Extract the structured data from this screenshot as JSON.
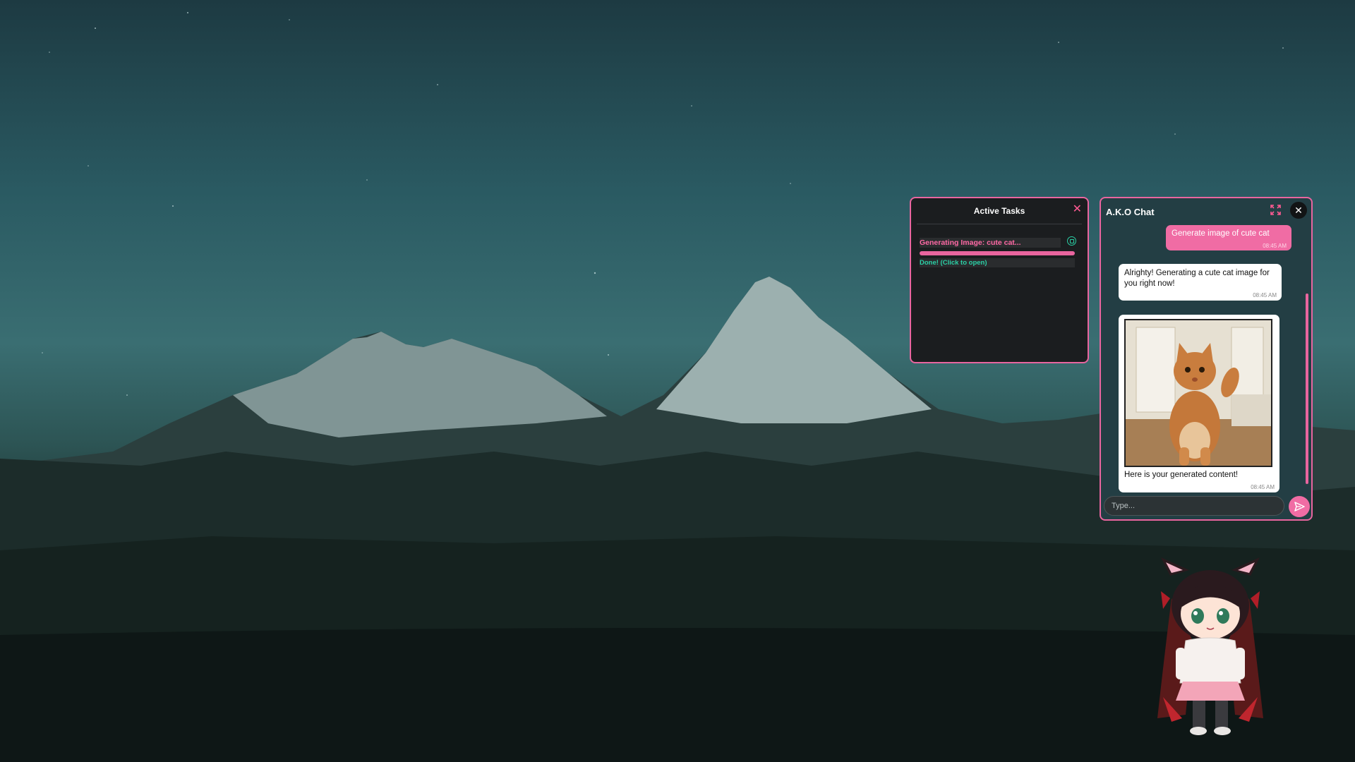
{
  "colors": {
    "accent": "#e9659f",
    "accent_text": "#ff69a5",
    "success": "#2ad0a6",
    "panel_bg": "#1b1d1f",
    "chat_bg": "#233e44"
  },
  "icons": {
    "tasks_close": "close-icon",
    "task_status": "open-file-icon",
    "chat_expand": "expand-icon",
    "chat_close": "close-icon",
    "send": "send-icon"
  },
  "tasks_panel": {
    "title": "Active Tasks",
    "close_glyph": "✕",
    "task": {
      "name": "Generating Image: cute cat...",
      "progress_percent": 100,
      "status": "Done! (Click to open)"
    }
  },
  "chat": {
    "title": "A.K.O Chat",
    "expand_glyph": "⤢",
    "close_glyph": "✕",
    "messages": [
      {
        "from": "user",
        "text": "Generate image of cute cat",
        "time": "08:45 AM"
      },
      {
        "from": "bot",
        "text": "Alrighty! Generating a cute cat image for you right now!",
        "time": "08:45 AM"
      },
      {
        "from": "bot",
        "text": "Here is your generated content!",
        "time": "08:45 AM"
      }
    ],
    "input": {
      "placeholder": "Type...",
      "value": ""
    }
  }
}
